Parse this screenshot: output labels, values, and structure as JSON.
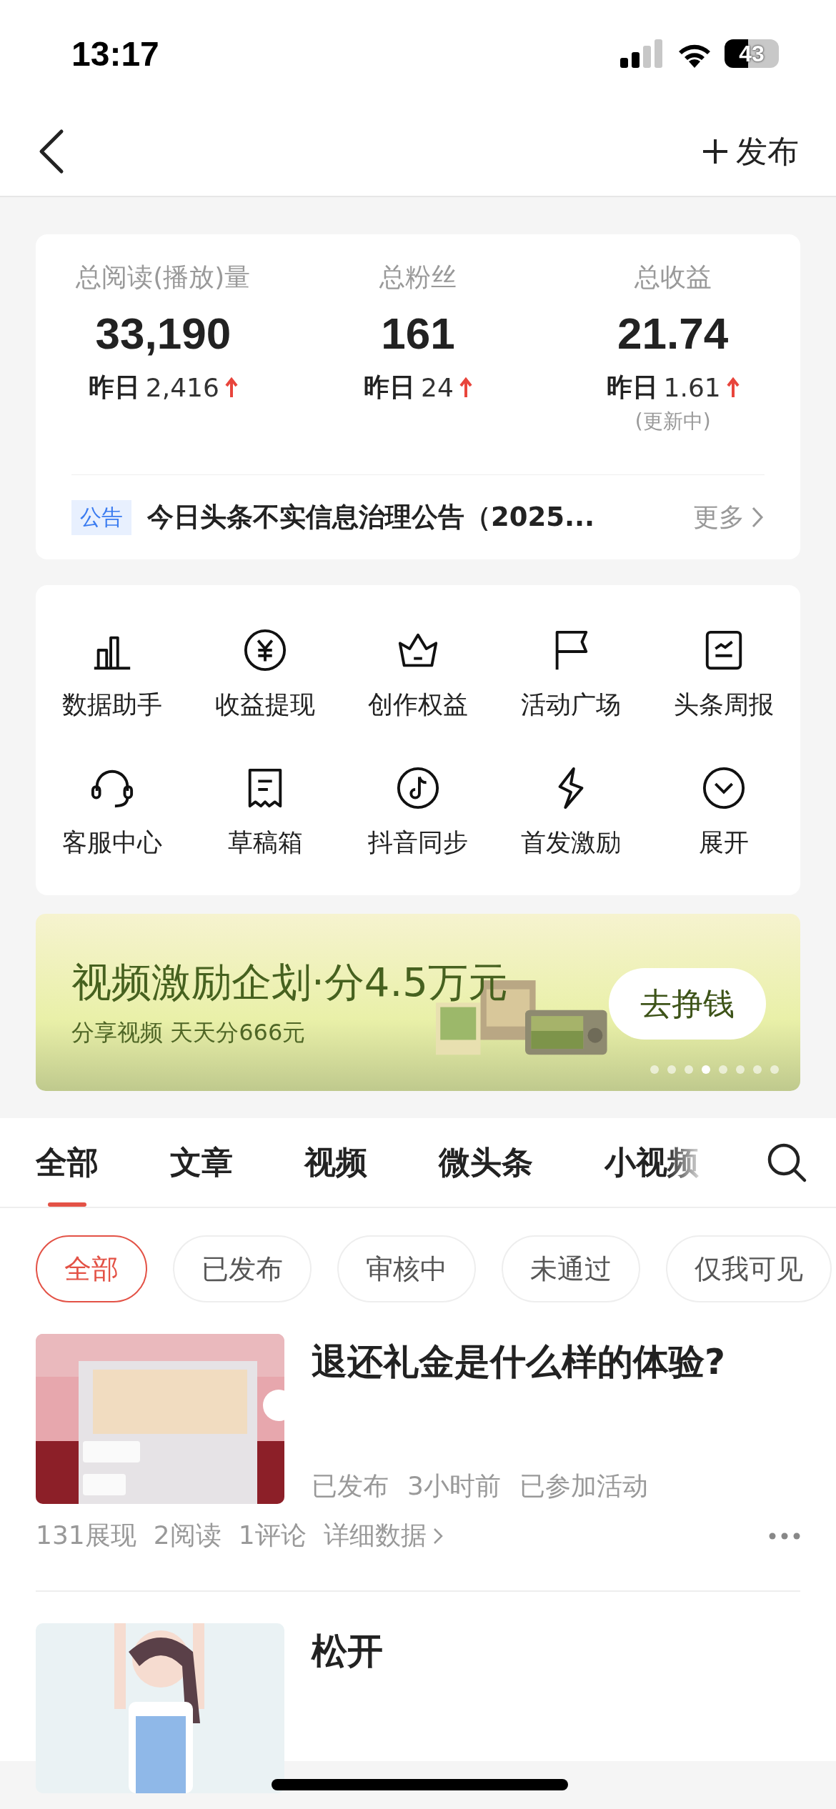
{
  "status_bar": {
    "time": "13:17",
    "battery": "43"
  },
  "nav": {
    "publish": "发布"
  },
  "stats": [
    {
      "label": "总阅读(播放)量",
      "value": "33,190",
      "yesterday_label": "昨日",
      "yesterday": "2,416",
      "rising": true
    },
    {
      "label": "总粉丝",
      "value": "161",
      "yesterday_label": "昨日",
      "yesterday": "24",
      "rising": true
    },
    {
      "label": "总收益",
      "value": "21.74",
      "yesterday_label": "昨日",
      "yesterday": "1.61",
      "rising": true,
      "note": "(更新中)"
    }
  ],
  "notice": {
    "tag": "公告",
    "text": "今日头条不实信息治理公告（2025...",
    "more": "更多"
  },
  "tools": [
    {
      "label": "数据助手"
    },
    {
      "label": "收益提现"
    },
    {
      "label": "创作权益"
    },
    {
      "label": "活动广场"
    },
    {
      "label": "头条周报"
    },
    {
      "label": "客服中心"
    },
    {
      "label": "草稿箱"
    },
    {
      "label": "抖音同步"
    },
    {
      "label": "首发激励"
    },
    {
      "label": "展开"
    }
  ],
  "banner": {
    "title": "视频激励企划·分4.5万元",
    "subtitle": "分享视频 天天分666元",
    "button": "去挣钱",
    "pages": [
      {
        "selected": false
      },
      {
        "selected": false
      },
      {
        "selected": false
      },
      {
        "selected": true
      },
      {
        "selected": false
      },
      {
        "selected": false
      },
      {
        "selected": false
      },
      {
        "selected": false
      }
    ]
  },
  "tabs": [
    {
      "label": "全部",
      "selected": true
    },
    {
      "label": "文章",
      "selected": false
    },
    {
      "label": "视频",
      "selected": false
    },
    {
      "label": "微头条",
      "selected": false
    },
    {
      "label": "小视频",
      "selected": false
    }
  ],
  "filters": [
    {
      "label": "全部",
      "selected": true
    },
    {
      "label": "已发布",
      "selected": false
    },
    {
      "label": "审核中",
      "selected": false
    },
    {
      "label": "未通过",
      "selected": false
    },
    {
      "label": "仅我可见",
      "selected": false
    }
  ],
  "articles": [
    {
      "title": "退还礼金是什么样的体验?",
      "status": "已发布",
      "time": "3小时前",
      "tag": "已参加活动",
      "impressions": "131展现",
      "reads": "2阅读",
      "comments": "1评论",
      "details": "详细数据"
    },
    {
      "title": "松开"
    }
  ]
}
